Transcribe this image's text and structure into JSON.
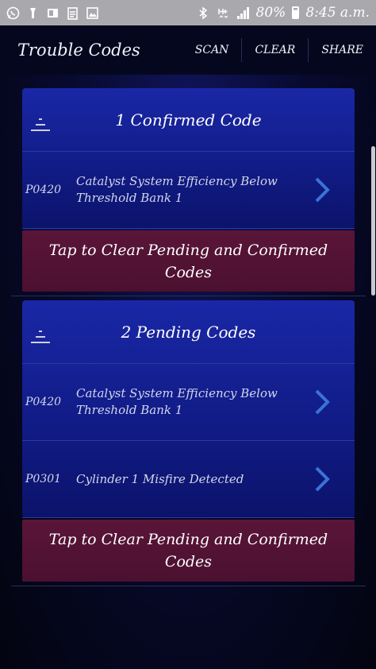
{
  "status_bar": {
    "left_icons": [
      "whatsapp-icon",
      "flashlight-icon",
      "office-icon",
      "clipboard-icon",
      "image-icon"
    ],
    "right_icons": [
      "bluetooth-icon",
      "hplus-icon",
      "signal-icon"
    ],
    "battery": "80%",
    "time": "8:45 a.m."
  },
  "app_bar": {
    "title": "Trouble Codes",
    "actions": {
      "scan": "SCAN",
      "clear": "CLEAR",
      "share": "SHARE"
    }
  },
  "confirmed": {
    "title": "1 Confirmed Code",
    "codes": [
      {
        "id": "P0420",
        "desc": "Catalyst System Efficiency Below Threshold Bank 1"
      }
    ],
    "clear_label": "Tap to Clear Pending and Confirmed Codes"
  },
  "pending": {
    "title": "2 Pending Codes",
    "codes": [
      {
        "id": "P0420",
        "desc": "Catalyst System Efficiency Below Threshold Bank 1"
      },
      {
        "id": "P0301",
        "desc": "Cylinder 1 Misfire Detected"
      }
    ],
    "clear_label": "Tap to Clear Pending and Confirmed Codes"
  },
  "colors": {
    "card_blue": "#1a27a6",
    "clear_red": "#5a1538",
    "chevron": "#3a73d8"
  }
}
